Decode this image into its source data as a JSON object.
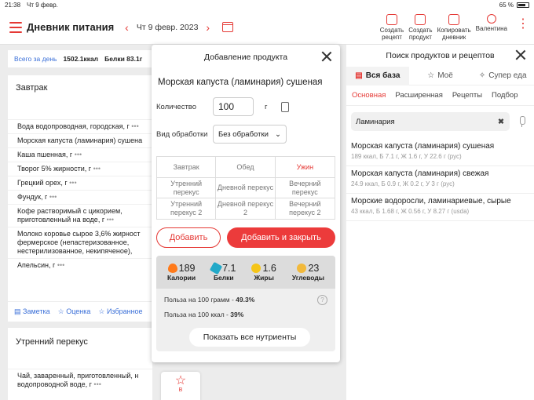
{
  "status": {
    "time": "21:38",
    "day": "Чт 9 февр.",
    "battery": "65 %"
  },
  "header": {
    "title": "Дневник питания",
    "date": "Чт 9 февр. 2023",
    "actions": [
      {
        "line1": "Создать",
        "line2": "рецепт"
      },
      {
        "line1": "Создать",
        "line2": "продукт"
      },
      {
        "line1": "Копировать",
        "line2": "дневник"
      },
      {
        "line1": "Валентина",
        "line2": ""
      }
    ]
  },
  "summary": {
    "label": "Всего за день",
    "kcal": "1502.1ккал",
    "protein": "Белки 83.1г"
  },
  "breakfast": {
    "title": "Завтрак",
    "items": [
      "Вода водопроводная, городская, г",
      "Морская капуста (ламинария) сушена",
      "Каша пшенная, г",
      "Творог 5% жирности, г",
      "Грецкий орех, г",
      "Фундук, г",
      "Кофе растворимый с цикорием,",
      "приготовленный на воде, г",
      "Молоко коровье сырое 3,6% жирност",
      "фермерское (непастеризованное,",
      "нестерилизованное, некипяченое),",
      "Апельсин, г"
    ],
    "footer": {
      "note": "Заметка",
      "rating": "Оценка",
      "favorites": "Избранное"
    }
  },
  "snack": {
    "title": "Утренний перекус",
    "items": [
      "Чай, заваренный, приготовленный, н",
      "водопроводной воде, г"
    ]
  },
  "modal": {
    "title": "Добавление продукта",
    "product": "Морская капуста (ламинария) сушеная",
    "qty_label": "Количество",
    "qty_value": "100",
    "unit": "г",
    "processing_label": "Вид обработки",
    "processing_value": "Без обработки",
    "meals": [
      [
        "Завтрак",
        "Обед",
        "Ужин"
      ],
      [
        "Утренний перекус",
        "Дневной перекус",
        "Вечерний перекус"
      ],
      [
        "Утренний перекус 2",
        "Дневной перекус 2",
        "Вечерний перекус 2"
      ]
    ],
    "add": "Добавить",
    "add_close": "Добавить и закрыть",
    "nutrients": [
      {
        "value": "189",
        "label": "Калории",
        "color": "#ff7a1a"
      },
      {
        "value": "7.1",
        "label": "Белки",
        "color": "#22a9c8"
      },
      {
        "value": "1.6",
        "label": "Жиры",
        "color": "#f5c518"
      },
      {
        "value": "23",
        "label": "Углеводы",
        "color": "#f2b93b"
      }
    ],
    "benefit_gram_label": "Польза на 100 грамм -",
    "benefit_gram_value": "49.3%",
    "benefit_kcal_label": "Польза на 100 ккал -",
    "benefit_kcal_value": "39%",
    "help": "?",
    "show_all": "Показать все нутриенты",
    "below_label": "В"
  },
  "search": {
    "title": "Поиск продуктов и рецептов",
    "tabs": [
      "Вся база",
      "Моё",
      "Супер еда"
    ],
    "subtabs": [
      "Основная",
      "Расширенная",
      "Рецепты",
      "Подбор"
    ],
    "query": "Ламинария",
    "results": [
      {
        "name": "Морская капуста (ламинария) сушеная",
        "meta": "189 ккал, Б 7.1 г, Ж 1.6 г, У 22.6 г (рус)"
      },
      {
        "name": "Морская капуста (ламинария) свежая",
        "meta": "24.9 ккал, Б 0.9 г, Ж 0.2 г, У 3 г (рус)"
      },
      {
        "name": "Морские водоросли, ламинариевые, сырые",
        "meta": "43 ккал, Б 1.68 г, Ж 0.56 г, У 8.27 г (usda)"
      }
    ]
  }
}
